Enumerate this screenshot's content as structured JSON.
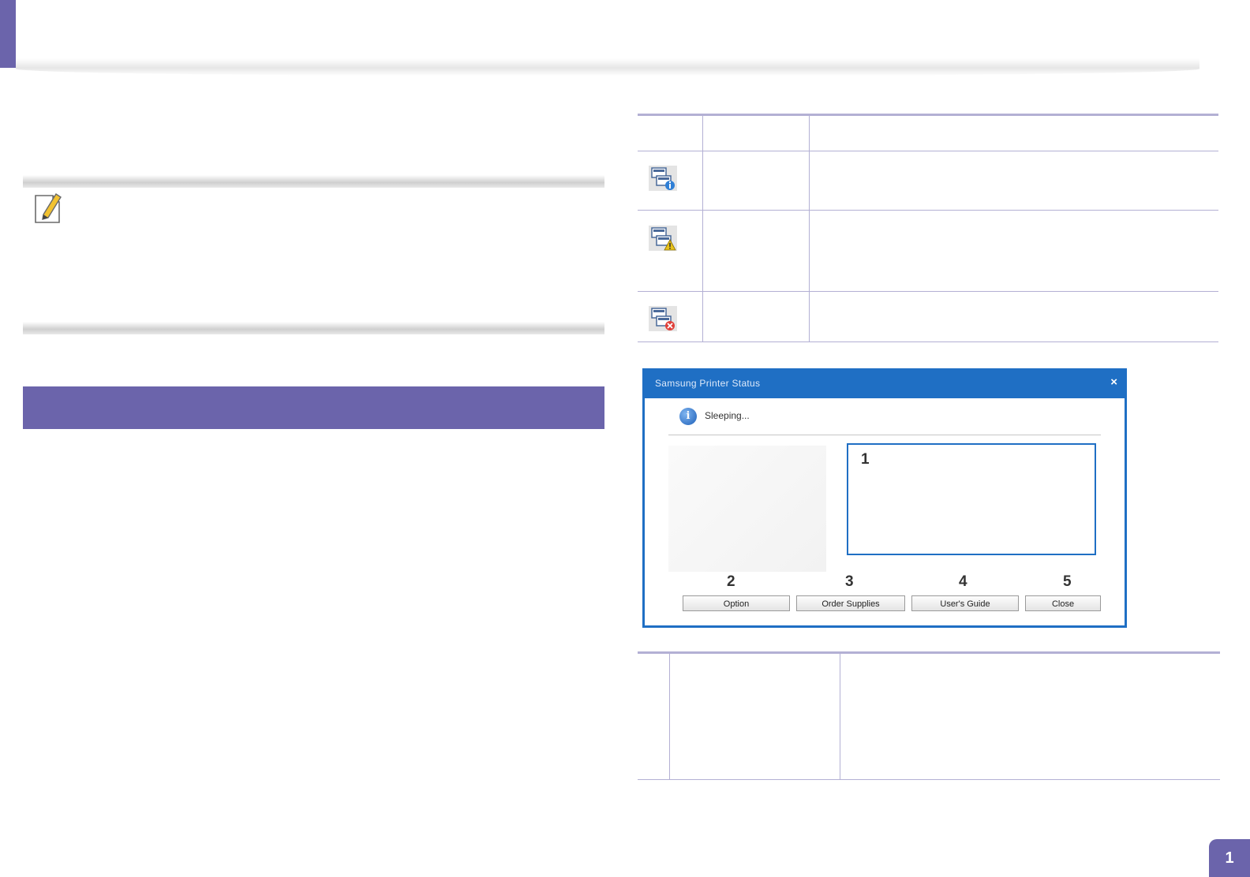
{
  "status_icons": [
    {
      "icon": "monitor-info-icon",
      "accent": "#2f7fd6"
    },
    {
      "icon": "monitor-warning-icon",
      "accent": "#e8c21a"
    },
    {
      "icon": "monitor-error-icon",
      "accent": "#e0403a"
    }
  ],
  "dialog": {
    "title": "Samsung Printer Status",
    "close_glyph": "×",
    "status_text": "Sleeping...",
    "info_glyph": "i",
    "callout_1": "1",
    "buttons": [
      {
        "callout": "2",
        "label": "Option"
      },
      {
        "callout": "3",
        "label": "Order Supplies"
      },
      {
        "callout": "4",
        "label": "User's Guide"
      },
      {
        "callout": "5",
        "label": "Close"
      }
    ]
  },
  "colors": {
    "accent": "#6b64ab",
    "rule": "#b3b0d4",
    "dialog_blue": "#1f6fc4"
  },
  "page": {
    "number": "1"
  }
}
